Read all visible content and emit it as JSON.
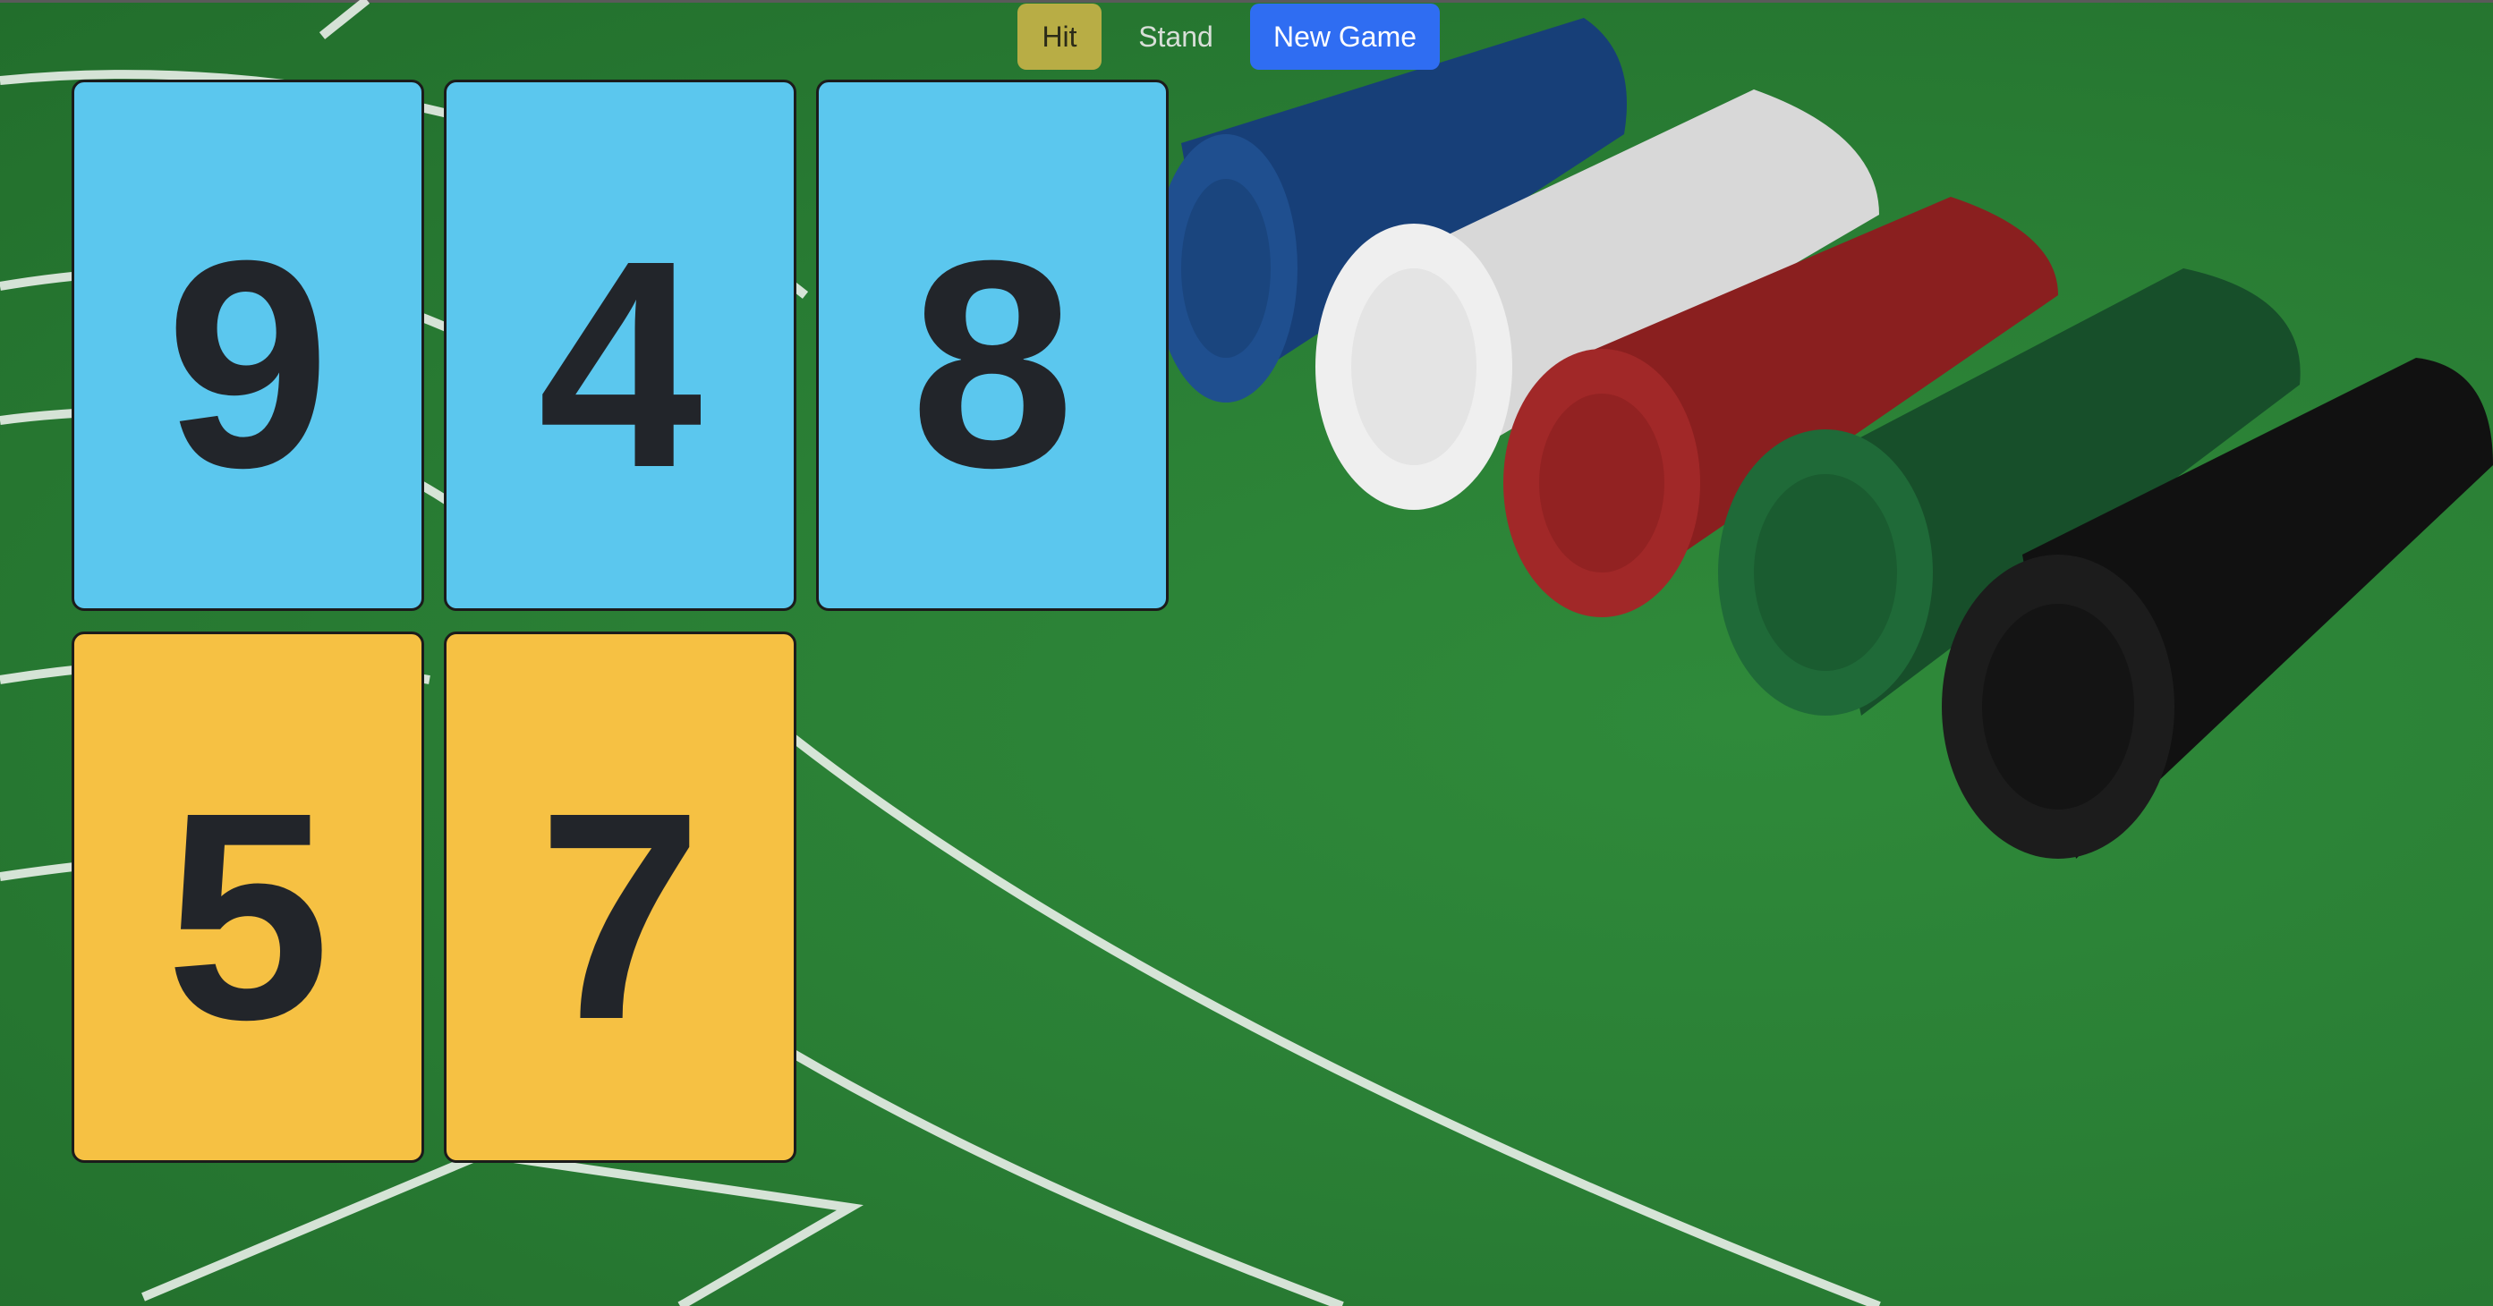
{
  "controls": {
    "hit_label": "Hit",
    "stand_label": "Stand",
    "new_game_label": "New Game"
  },
  "colors": {
    "felt": "#2a7f35",
    "dealer_card": "#5bc7ee",
    "player_card": "#f6c143",
    "hit_button": "#b8ad45",
    "new_game_button": "#2f6df2"
  },
  "dealer_hand": {
    "cards": [
      "9",
      "4",
      "8"
    ]
  },
  "player_hand": {
    "cards": [
      "5",
      "7"
    ]
  },
  "background": {
    "description_icon": "poker-chips-image",
    "chip_colors": [
      "#1f4f8f",
      "#e8e8e8",
      "#9e2525",
      "#1f6a38",
      "#1c1c1c"
    ]
  }
}
